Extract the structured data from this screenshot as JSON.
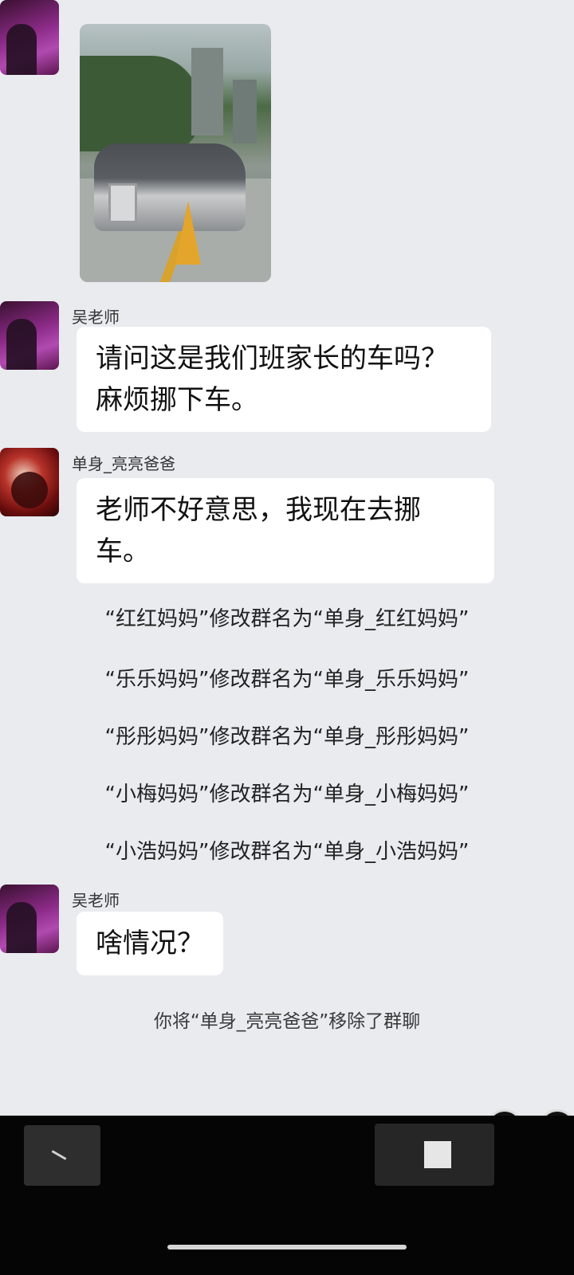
{
  "messages": [
    {
      "sender": "吴老师",
      "lines": [
        "请问这是我们班家长的车吗？",
        "麻烦挪下车。"
      ]
    },
    {
      "sender": "单身_亮亮爸爸",
      "lines": [
        "老师不好意思，我现在去挪",
        "车。"
      ]
    },
    {
      "sender": "吴老师",
      "lines": [
        "啥情况？"
      ]
    }
  ],
  "system_notices": [
    "“红红妈妈”修改群名为“单身_红红妈妈”",
    "“乐乐妈妈”修改群名为“单身_乐乐妈妈”",
    "“彤彤妈妈”修改群名为“单身_彤彤妈妈”",
    "“小梅妈妈”修改群名为“单身_小梅妈妈”",
    "“小浩妈妈”修改群名为“单身_小浩妈妈”"
  ],
  "removal_notice": "你将“单身_亮亮爸爸”移除了群聊",
  "photo": {
    "description_icon": "car-photo"
  }
}
